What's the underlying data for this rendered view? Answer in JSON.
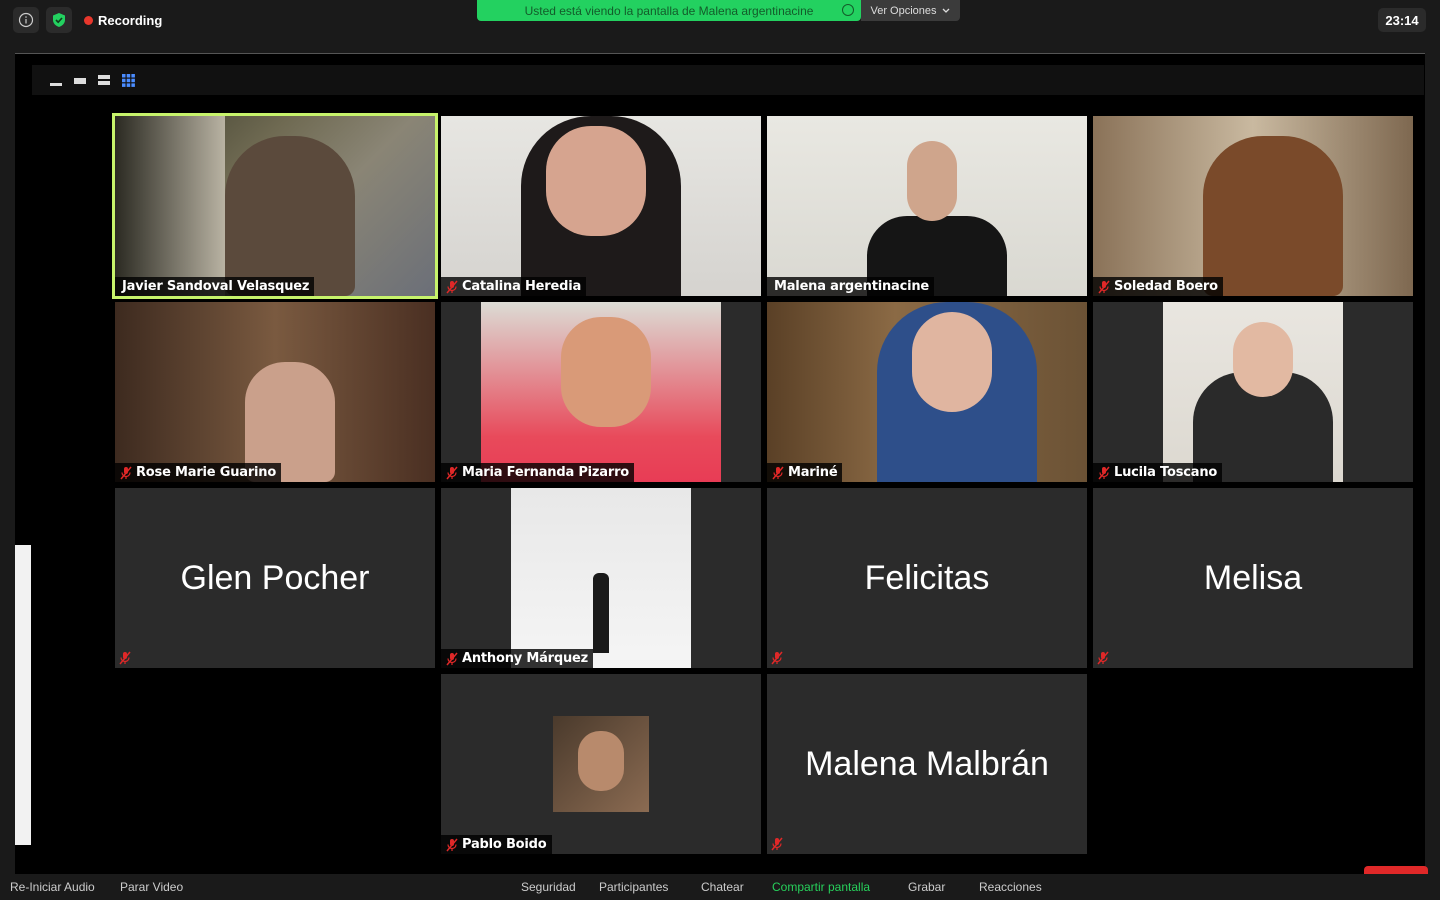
{
  "topbar": {
    "recording_label": "Recording",
    "banner_text": "Usted está viendo la pantalla de Malena argentinacine",
    "options_label": "Ver Opciones",
    "clock": "23:14",
    "colors": {
      "recording_dot": "#e8372c",
      "banner_bg": "#23d160",
      "shield": "#23d160"
    }
  },
  "participants": [
    {
      "name": "Javier Sandoval Velasquez",
      "muted": false,
      "video": true,
      "active": true
    },
    {
      "name": "Catalina Heredia",
      "muted": true,
      "video": true
    },
    {
      "name": "Malena argentinacine",
      "muted": false,
      "video": true
    },
    {
      "name": "Soledad Boero",
      "muted": true,
      "video": true
    },
    {
      "name": "Rose Marie Guarino",
      "muted": true,
      "video": true
    },
    {
      "name": "Maria Fernanda Pizarro",
      "muted": true,
      "video": true
    },
    {
      "name": "Mariné",
      "muted": true,
      "video": true
    },
    {
      "name": "Lucila Toscano",
      "muted": true,
      "video": true
    },
    {
      "name": "Glen Pocher",
      "muted": true,
      "video": false
    },
    {
      "name": "Anthony Márquez",
      "muted": true,
      "video": true
    },
    {
      "name": "Felicitas",
      "muted": true,
      "video": false
    },
    {
      "name": "Melisa",
      "muted": true,
      "video": false
    },
    {
      "name": "Pablo Boido",
      "muted": true,
      "video": true
    },
    {
      "name": "Malena Malbrán",
      "muted": true,
      "video": false
    }
  ],
  "bottombar": {
    "audio": "Re-Iniciar Audio",
    "video": "Parar Video",
    "security": "Seguridad",
    "participants": "Participantes",
    "chat": "Chatear",
    "share": "Compartir pantalla",
    "record": "Grabar",
    "reactions": "Reacciones"
  },
  "colors": {
    "active_speaker": "#c7f36b",
    "mute_icon": "#e02828",
    "share_text": "#27d05b"
  }
}
